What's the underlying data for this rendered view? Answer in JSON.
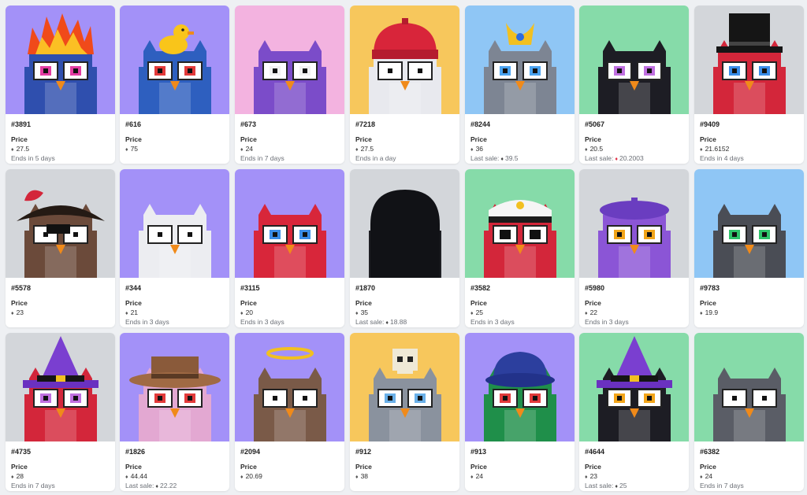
{
  "price_label": "Price",
  "colors": {
    "purple": "#a391f8",
    "pink": "#f3b3e0",
    "yellow": "#f7c75c",
    "blue": "#8fc6f5",
    "green": "#86dba9",
    "gray": "#d3d6da"
  },
  "cards": [
    {
      "id": "#3891",
      "price": "27.5",
      "note": "Ends in 5 days",
      "bg": "purple",
      "body": "#2f4fae",
      "hat": "flame-icon",
      "eyes": "#e33da3"
    },
    {
      "id": "#616",
      "price": "75",
      "note": "",
      "bg": "purple",
      "body": "#2e5fbf",
      "hat": "duck-icon",
      "eyes": "#e23a3a"
    },
    {
      "id": "#673",
      "price": "24",
      "note": "Ends in 7 days",
      "bg": "pink",
      "body": "#7b4cc9",
      "hat": "none",
      "eyes": "#f2f2f2"
    },
    {
      "id": "#7218",
      "price": "27.5",
      "note": "Ends in a day",
      "bg": "yellow",
      "body": "#e8e9ee",
      "hat": "beanie-icon",
      "eyes": "#ffffff"
    },
    {
      "id": "#8244",
      "price": "36",
      "note": "",
      "last_sale_label": "Last sale:",
      "last_sale": "39.5",
      "sale_icon": "gray",
      "bg": "blue",
      "body": "#7d8593",
      "hat": "crown-icon",
      "eyes": "#4aa3f0"
    },
    {
      "id": "#5067",
      "price": "20.5",
      "note": "",
      "last_sale_label": "Last sale:",
      "last_sale": "20.2003",
      "sale_icon": "red",
      "bg": "green",
      "body": "#1d1d24",
      "hat": "none",
      "eyes": "#c070e0"
    },
    {
      "id": "#9409",
      "price": "21.6152",
      "note": "Ends in 4 days",
      "bg": "gray",
      "body": "#d3263a",
      "hat": "tophat-icon",
      "eyes": "#3a8de8"
    },
    {
      "id": "#5578",
      "price": "23",
      "note": "",
      "bg": "gray",
      "body": "#6b4a3a",
      "hat": "pirate-hat-icon",
      "eyes": "#ffffff"
    },
    {
      "id": "#344",
      "price": "21",
      "note": "Ends in 3 days",
      "bg": "purple",
      "body": "#ecedf1",
      "hat": "none",
      "eyes": "#ffffff"
    },
    {
      "id": "#3115",
      "price": "20",
      "note": "Ends in 3 days",
      "bg": "purple",
      "body": "#d8263a",
      "hat": "none",
      "eyes": "#3a8de8"
    },
    {
      "id": "#1870",
      "price": "35",
      "note": "",
      "last_sale_label": "Last sale:",
      "last_sale": "18.88",
      "sale_icon": "gray",
      "bg": "gray",
      "body": "#1e1f24",
      "hat": "hood-icon",
      "eyes": "#f05a1a"
    },
    {
      "id": "#3582",
      "price": "25",
      "note": "Ends in 3 days",
      "bg": "green",
      "body": "#d3263a",
      "hat": "captain-hat-icon",
      "eyes": "#111111"
    },
    {
      "id": "#5980",
      "price": "22",
      "note": "Ends in 3 days",
      "bg": "gray",
      "body": "#8b55d6",
      "hat": "beret-icon",
      "eyes": "#f2a51a"
    },
    {
      "id": "#9783",
      "price": "19.9",
      "note": "",
      "bg": "blue",
      "body": "#4a4d55",
      "hat": "none",
      "eyes": "#2fc46a"
    },
    {
      "id": "#4735",
      "price": "28",
      "note": "Ends in 7 days",
      "bg": "gray",
      "body": "#d3263a",
      "hat": "wizard-hat-icon",
      "eyes": "#c070e0"
    },
    {
      "id": "#1826",
      "price": "44.44",
      "note": "",
      "last_sale_label": "Last sale:",
      "last_sale": "22.22",
      "sale_icon": "gray",
      "bg": "purple",
      "body": "#e3a8d2",
      "hat": "cowboy-hat-icon",
      "eyes": "#e23a3a"
    },
    {
      "id": "#2094",
      "price": "20.69",
      "note": "",
      "bg": "purple",
      "body": "#7a5a48",
      "hat": "halo-icon",
      "eyes": "#ffffff"
    },
    {
      "id": "#912",
      "price": "38",
      "note": "",
      "bg": "yellow",
      "body": "#8a929e",
      "hat": "skull-icon",
      "eyes": "#6ab0e8"
    },
    {
      "id": "#913",
      "price": "24",
      "note": "",
      "bg": "purple",
      "body": "#1f8f4a",
      "hat": "bucket-hat-icon",
      "eyes": "#e23a3a"
    },
    {
      "id": "#4644",
      "price": "23",
      "note": "",
      "last_sale_label": "Last sale:",
      "last_sale": "25",
      "sale_icon": "gray",
      "bg": "green",
      "body": "#1d1d24",
      "hat": "wizard-hat-icon",
      "eyes": "#f2a51a"
    },
    {
      "id": "#6382",
      "price": "24",
      "note": "Ends in 7 days",
      "bg": "green",
      "body": "#5a5d66",
      "hat": "none",
      "eyes": "#ffffff"
    }
  ]
}
